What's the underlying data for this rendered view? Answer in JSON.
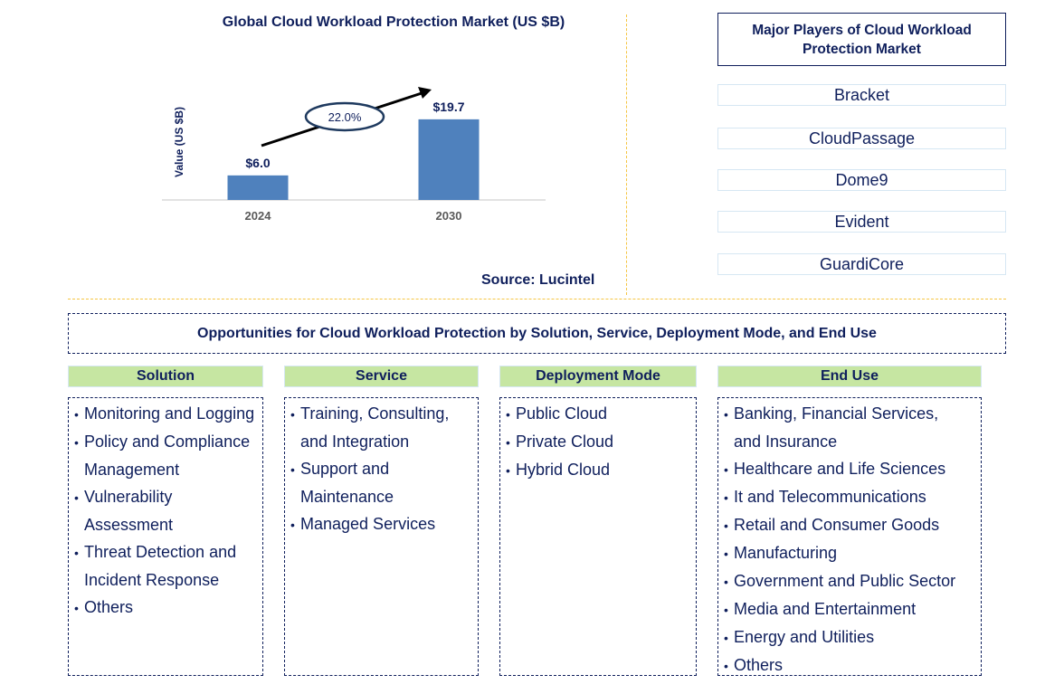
{
  "chart_data": {
    "type": "bar",
    "title": "Global Cloud Workload Protection Market (US $B)",
    "xlabel": "",
    "ylabel": "Value (US $B)",
    "categories": [
      "2024",
      "2030"
    ],
    "values": [
      6.0,
      19.7
    ],
    "data_labels": [
      "$6.0",
      "$19.7"
    ],
    "ylim": [
      0,
      21
    ],
    "grid": false,
    "bar_color": "#4f81bd",
    "annotation": {
      "type": "growth-arrow",
      "label": "22.0%",
      "meaning": "CAGR"
    },
    "source": "Source: Lucintel"
  },
  "players": {
    "title": "Major Players of Cloud Workload Protection Market",
    "items": [
      "Bracket",
      "CloudPassage",
      "Dome9",
      "Evident",
      "GuardiCore"
    ]
  },
  "opportunities": {
    "title": "Opportunities for Cloud Workload Protection by Solution, Service, Deployment Mode, and End Use",
    "segments": [
      {
        "heading": "Solution",
        "items": [
          "Monitoring and Logging",
          "Policy and Compliance Management",
          "Vulnerability Assessment",
          "Threat Detection and Incident Response",
          "Others"
        ]
      },
      {
        "heading": "Service",
        "items": [
          "Training, Consulting, and Integration",
          "Support and Maintenance",
          "Managed Services"
        ]
      },
      {
        "heading": "Deployment Mode",
        "items": [
          "Public Cloud",
          "Private Cloud",
          "Hybrid Cloud"
        ]
      },
      {
        "heading": "End Use",
        "items": [
          "Banking, Financial Services, and Insurance",
          "Healthcare and Life Sciences",
          "It and Telecommunications",
          "Retail and Consumer Goods",
          "Manufacturing",
          "Government and Public Sector",
          "Media and Entertainment",
          "Energy and Utilities",
          "Others"
        ]
      }
    ]
  },
  "colors": {
    "text": "#0f1f5c",
    "bar": "#4f81bd",
    "segment_header": "#c6e6a2",
    "divider": "#f5c542",
    "player_border": "#d6e7f3"
  }
}
